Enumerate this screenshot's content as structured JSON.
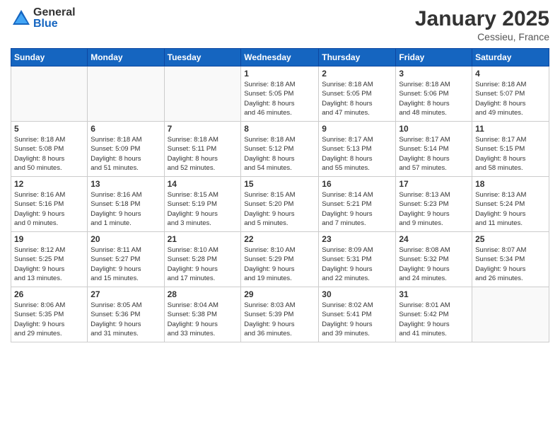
{
  "logo": {
    "general": "General",
    "blue": "Blue"
  },
  "title": "January 2025",
  "location": "Cessieu, France",
  "weekdays": [
    "Sunday",
    "Monday",
    "Tuesday",
    "Wednesday",
    "Thursday",
    "Friday",
    "Saturday"
  ],
  "weeks": [
    [
      {
        "day": "",
        "info": ""
      },
      {
        "day": "",
        "info": ""
      },
      {
        "day": "",
        "info": ""
      },
      {
        "day": "1",
        "info": "Sunrise: 8:18 AM\nSunset: 5:05 PM\nDaylight: 8 hours\nand 46 minutes."
      },
      {
        "day": "2",
        "info": "Sunrise: 8:18 AM\nSunset: 5:05 PM\nDaylight: 8 hours\nand 47 minutes."
      },
      {
        "day": "3",
        "info": "Sunrise: 8:18 AM\nSunset: 5:06 PM\nDaylight: 8 hours\nand 48 minutes."
      },
      {
        "day": "4",
        "info": "Sunrise: 8:18 AM\nSunset: 5:07 PM\nDaylight: 8 hours\nand 49 minutes."
      }
    ],
    [
      {
        "day": "5",
        "info": "Sunrise: 8:18 AM\nSunset: 5:08 PM\nDaylight: 8 hours\nand 50 minutes."
      },
      {
        "day": "6",
        "info": "Sunrise: 8:18 AM\nSunset: 5:09 PM\nDaylight: 8 hours\nand 51 minutes."
      },
      {
        "day": "7",
        "info": "Sunrise: 8:18 AM\nSunset: 5:11 PM\nDaylight: 8 hours\nand 52 minutes."
      },
      {
        "day": "8",
        "info": "Sunrise: 8:18 AM\nSunset: 5:12 PM\nDaylight: 8 hours\nand 54 minutes."
      },
      {
        "day": "9",
        "info": "Sunrise: 8:17 AM\nSunset: 5:13 PM\nDaylight: 8 hours\nand 55 minutes."
      },
      {
        "day": "10",
        "info": "Sunrise: 8:17 AM\nSunset: 5:14 PM\nDaylight: 8 hours\nand 57 minutes."
      },
      {
        "day": "11",
        "info": "Sunrise: 8:17 AM\nSunset: 5:15 PM\nDaylight: 8 hours\nand 58 minutes."
      }
    ],
    [
      {
        "day": "12",
        "info": "Sunrise: 8:16 AM\nSunset: 5:16 PM\nDaylight: 9 hours\nand 0 minutes."
      },
      {
        "day": "13",
        "info": "Sunrise: 8:16 AM\nSunset: 5:18 PM\nDaylight: 9 hours\nand 1 minute."
      },
      {
        "day": "14",
        "info": "Sunrise: 8:15 AM\nSunset: 5:19 PM\nDaylight: 9 hours\nand 3 minutes."
      },
      {
        "day": "15",
        "info": "Sunrise: 8:15 AM\nSunset: 5:20 PM\nDaylight: 9 hours\nand 5 minutes."
      },
      {
        "day": "16",
        "info": "Sunrise: 8:14 AM\nSunset: 5:21 PM\nDaylight: 9 hours\nand 7 minutes."
      },
      {
        "day": "17",
        "info": "Sunrise: 8:13 AM\nSunset: 5:23 PM\nDaylight: 9 hours\nand 9 minutes."
      },
      {
        "day": "18",
        "info": "Sunrise: 8:13 AM\nSunset: 5:24 PM\nDaylight: 9 hours\nand 11 minutes."
      }
    ],
    [
      {
        "day": "19",
        "info": "Sunrise: 8:12 AM\nSunset: 5:25 PM\nDaylight: 9 hours\nand 13 minutes."
      },
      {
        "day": "20",
        "info": "Sunrise: 8:11 AM\nSunset: 5:27 PM\nDaylight: 9 hours\nand 15 minutes."
      },
      {
        "day": "21",
        "info": "Sunrise: 8:10 AM\nSunset: 5:28 PM\nDaylight: 9 hours\nand 17 minutes."
      },
      {
        "day": "22",
        "info": "Sunrise: 8:10 AM\nSunset: 5:29 PM\nDaylight: 9 hours\nand 19 minutes."
      },
      {
        "day": "23",
        "info": "Sunrise: 8:09 AM\nSunset: 5:31 PM\nDaylight: 9 hours\nand 22 minutes."
      },
      {
        "day": "24",
        "info": "Sunrise: 8:08 AM\nSunset: 5:32 PM\nDaylight: 9 hours\nand 24 minutes."
      },
      {
        "day": "25",
        "info": "Sunrise: 8:07 AM\nSunset: 5:34 PM\nDaylight: 9 hours\nand 26 minutes."
      }
    ],
    [
      {
        "day": "26",
        "info": "Sunrise: 8:06 AM\nSunset: 5:35 PM\nDaylight: 9 hours\nand 29 minutes."
      },
      {
        "day": "27",
        "info": "Sunrise: 8:05 AM\nSunset: 5:36 PM\nDaylight: 9 hours\nand 31 minutes."
      },
      {
        "day": "28",
        "info": "Sunrise: 8:04 AM\nSunset: 5:38 PM\nDaylight: 9 hours\nand 33 minutes."
      },
      {
        "day": "29",
        "info": "Sunrise: 8:03 AM\nSunset: 5:39 PM\nDaylight: 9 hours\nand 36 minutes."
      },
      {
        "day": "30",
        "info": "Sunrise: 8:02 AM\nSunset: 5:41 PM\nDaylight: 9 hours\nand 39 minutes."
      },
      {
        "day": "31",
        "info": "Sunrise: 8:01 AM\nSunset: 5:42 PM\nDaylight: 9 hours\nand 41 minutes."
      },
      {
        "day": "",
        "info": ""
      }
    ]
  ]
}
